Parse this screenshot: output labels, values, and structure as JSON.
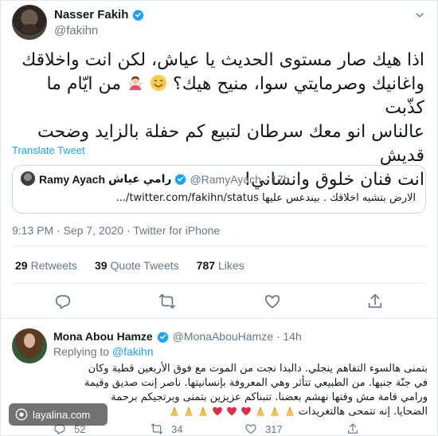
{
  "tweet": {
    "author_name": "Nasser Fakih",
    "author_handle": "@fakihn",
    "text_line1": "اذا هيك صار مستوى الحديث يا عياش، لكن انت واخلاقك",
    "text_line2_a": "واغانيك وصرمايتي سوا، منيح هيك؟",
    "text_line2_b": "من ايّام ما كذّبت",
    "text_line3": "عالناس انو معك سرطان لتبيع كم حفلة بالزايد وضحت قديش",
    "text_line4": "انت فنان خلوق وانساني!",
    "translate_label": "Translate Tweet",
    "timestamp": "9:13 PM · Sep 7, 2020 · Twitter for iPhone"
  },
  "quote": {
    "name_latin": "Ramy Ayach",
    "name_arabic": "رامي عياش",
    "handle_time": "@RamyAyach · 17h",
    "text": "الارض بتشبه اخلاقك . بيندعس عليها twitter.com/fakihn/status/..."
  },
  "stats": [
    {
      "num": "29",
      "label": "Retweets"
    },
    {
      "num": "39",
      "label": "Quote Tweets"
    },
    {
      "num": "787",
      "label": "Likes"
    }
  ],
  "reply": {
    "name": "Mona Abou Hamze",
    "handle_time": "@MonaAbouHamze · 14h",
    "replying_prefix": "Replying to",
    "replying_mention": "@fakihn",
    "line1": "بتمنى هالسوء التفاهم ينجلي. دالبدا نجت من الموت مع فوق الأربعين قطبة وكان",
    "line2": "في جنّة جنبها. من الطبيعي تتأثر وهي المعروفة بإنسانيتها. ناصر إنت صديق وقيمة",
    "line3": "ورامي قامة مش وقتها نهشم بعضنا. تنبناكم عزيزين بتمنى وبرتجيكم برحمة",
    "line4": "الضحايا. إنه تتمحى هالتغريدات",
    "reply_count": "52",
    "retweet_count": "34",
    "like_count": "317"
  },
  "watermark": "layalina.com",
  "colors": {
    "accent": "#1da1f2",
    "muted": "#657786",
    "text": "#14171a",
    "border": "#e1e8ed"
  },
  "icons": [
    "verified-badge-icon",
    "chevron-down-icon",
    "reply-icon",
    "retweet-icon",
    "like-icon",
    "share-icon",
    "smiling-face-icon",
    "woman-gesturing-ok-icon",
    "folded-hands-icon",
    "red-heart-icon"
  ]
}
